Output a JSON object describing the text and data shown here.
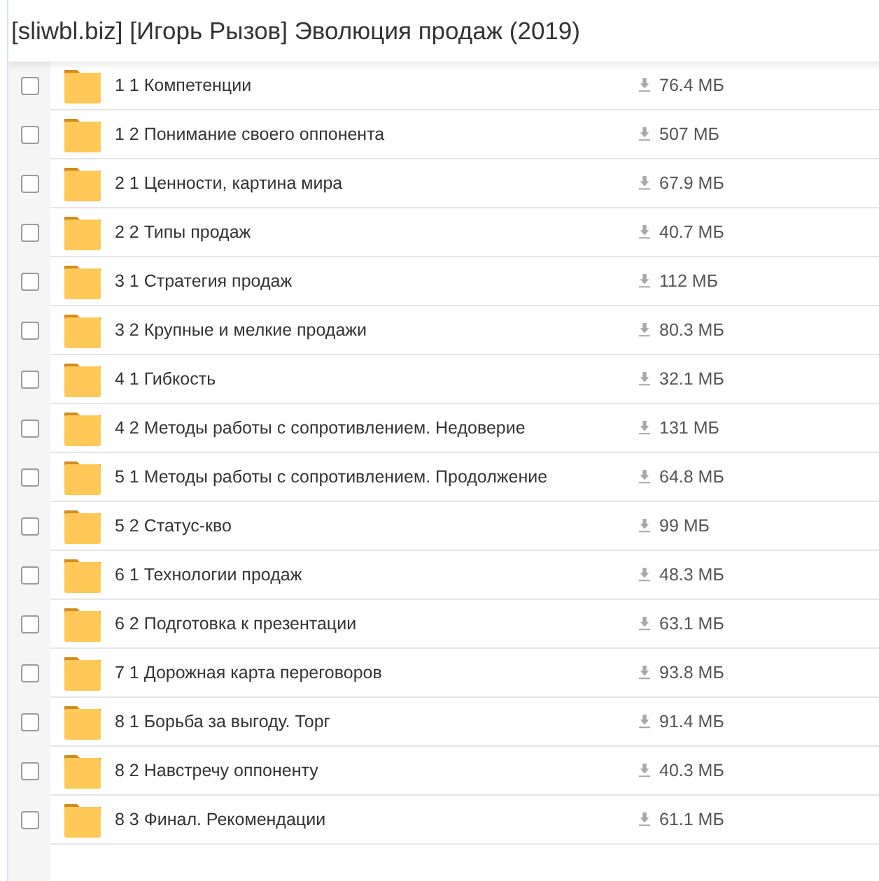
{
  "title": "[sliwbl.biz] [Игорь Рызов] Эволюция продаж (2019)",
  "files": [
    {
      "name": "1 1 Компетенции",
      "size": "76.4 МБ",
      "checked": false
    },
    {
      "name": "1 2 Понимание своего оппонента",
      "size": "507 МБ",
      "checked": false
    },
    {
      "name": "2 1 Ценности, картина мира",
      "size": "67.9 МБ",
      "checked": false
    },
    {
      "name": "2 2 Типы продаж",
      "size": "40.7 МБ",
      "checked": false
    },
    {
      "name": "3 1 Стратегия продаж",
      "size": "112 МБ",
      "checked": false
    },
    {
      "name": "3 2 Крупные и мелкие продажи",
      "size": "80.3 МБ",
      "checked": false
    },
    {
      "name": "4 1 Гибкость",
      "size": "32.1 МБ",
      "checked": false
    },
    {
      "name": "4 2 Методы работы с сопротивлением. Недоверие",
      "size": "131 МБ",
      "checked": false
    },
    {
      "name": "5 1 Методы работы с сопротивлением. Продолжение",
      "size": "64.8 МБ",
      "checked": false
    },
    {
      "name": "5 2 Статус-кво",
      "size": "99 МБ",
      "checked": false
    },
    {
      "name": "6 1 Технологии продаж",
      "size": "48.3 МБ",
      "checked": false
    },
    {
      "name": "6 2 Подготовка к презентации",
      "size": "63.1 МБ",
      "checked": false
    },
    {
      "name": "7 1 Дорожная карта переговоров",
      "size": "93.8 МБ",
      "checked": false
    },
    {
      "name": "8 1 Борьба за выгоду. Торг",
      "size": "91.4 МБ",
      "checked": false
    },
    {
      "name": "8 2 Навстречу оппоненту",
      "size": "40.3 МБ",
      "checked": false
    },
    {
      "name": "8 3 Финал. Рекомендации",
      "size": "61.1 МБ",
      "checked": false
    }
  ]
}
